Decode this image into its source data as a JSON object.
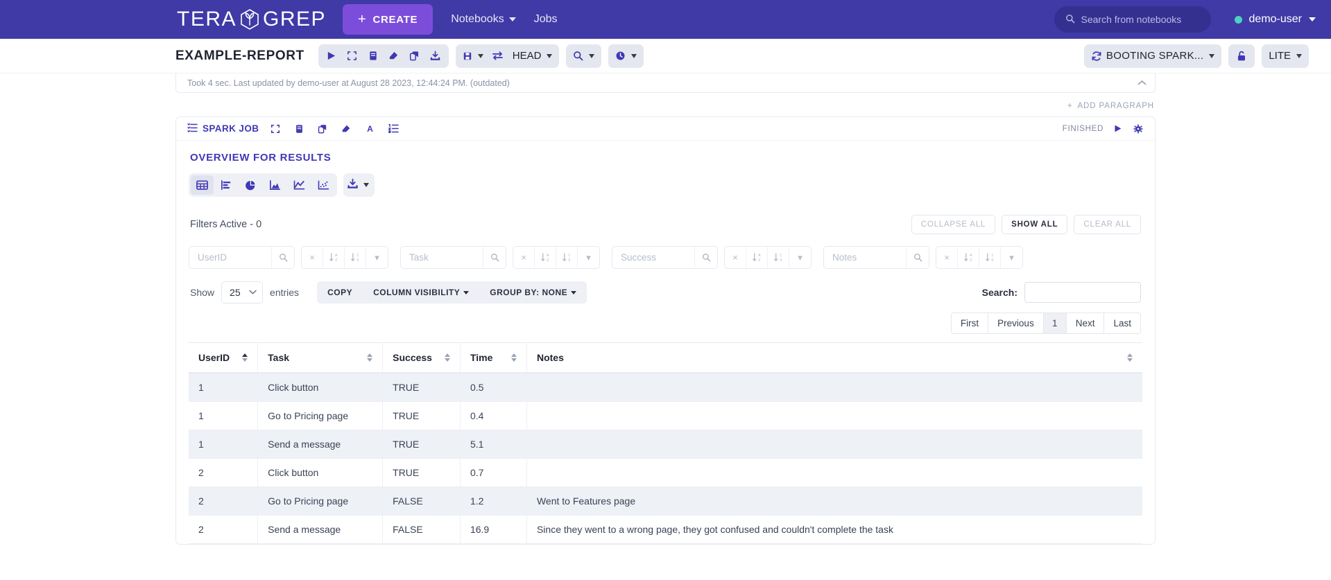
{
  "navbar": {
    "brand": "TERA GREP",
    "brand_left": "TERA",
    "brand_right": "GREP",
    "create_label": "CREATE",
    "create_plus": "+",
    "links": [
      {
        "label": "Notebooks",
        "has_caret": true
      },
      {
        "label": "Jobs",
        "has_caret": false
      }
    ],
    "search_placeholder": "Search from notebooks",
    "user": "demo-user",
    "accent": "#3f3aa6",
    "create_color": "#7c4ddb",
    "status_dot_color": "#4fd1c0"
  },
  "notebook_toolbar": {
    "title": "EXAMPLE-REPORT",
    "run_icons": [
      "run-icon",
      "collapse-icon",
      "list-icon",
      "eraser-icon",
      "clone-icon",
      "export-icon"
    ],
    "version_group": {
      "save_label": "",
      "revision_label": "HEAD"
    },
    "search_label": "",
    "clock_label": "",
    "spark_status": "BOOTING SPARK...",
    "lock_label": "",
    "mode_label": "LITE"
  },
  "status_line": {
    "text": "Took 4 sec. Last updated by demo-user at August 28 2023, 12:44:24 PM. (outdated)"
  },
  "add_paragraph": {
    "label": "ADD PARAGRAPH",
    "plus": "+"
  },
  "paragraph": {
    "tag": "SPARK JOB",
    "icons": [
      "expand-icon",
      "book-icon",
      "clone-icon",
      "eraser-icon",
      "font-icon",
      "order-list-icon"
    ],
    "status": "FINISHED",
    "overview_title": "OVERVIEW FOR RESULTS"
  },
  "viz": {
    "buttons": [
      {
        "name": "table-view-icon",
        "active": true
      },
      {
        "name": "bar-chart-icon",
        "active": false
      },
      {
        "name": "pie-chart-icon",
        "active": false
      },
      {
        "name": "area-chart-icon",
        "active": false
      },
      {
        "name": "line-chart-icon",
        "active": false
      },
      {
        "name": "scatter-chart-icon",
        "active": false
      }
    ],
    "download_icon": "download-icon"
  },
  "filters": {
    "active_label": "Filters Active - 0",
    "collapse_all": "COLLAPSE ALL",
    "show_all": "SHOW ALL",
    "clear_all": "CLEAR ALL",
    "columns": [
      {
        "placeholder": "UserID",
        "value": ""
      },
      {
        "placeholder": "Task",
        "value": ""
      },
      {
        "placeholder": "Success",
        "value": ""
      },
      {
        "placeholder": "Notes",
        "value": ""
      }
    ],
    "clear_glyph": "×",
    "sort_az_glyph": "↓A\nZ",
    "sort_num_glyph": "↓1\n9",
    "more_glyph": "▾"
  },
  "table_controls": {
    "show_label": "Show",
    "entries_value": "25",
    "entries_label": "entries",
    "copy_label": "COPY",
    "column_visibility_label": "COLUMN VISIBILITY",
    "group_by_label": "GROUP BY: NONE",
    "search_label": "Search:",
    "search_value": "",
    "pagination": {
      "first": "First",
      "previous": "Previous",
      "current": "1",
      "next": "Next",
      "last": "Last"
    }
  },
  "table": {
    "columns": [
      {
        "label": "UserID",
        "sorted": "asc"
      },
      {
        "label": "Task",
        "sorted": "none"
      },
      {
        "label": "Success",
        "sorted": "none"
      },
      {
        "label": "Time",
        "sorted": "none"
      },
      {
        "label": "Notes",
        "sorted": "none"
      }
    ],
    "rows": [
      {
        "UserID": "1",
        "Task": "Click button",
        "Success": "TRUE",
        "Time": "0.5",
        "Notes": ""
      },
      {
        "UserID": "1",
        "Task": "Go to Pricing page",
        "Success": "TRUE",
        "Time": "0.4",
        "Notes": ""
      },
      {
        "UserID": "1",
        "Task": "Send a message",
        "Success": "TRUE",
        "Time": "5.1",
        "Notes": ""
      },
      {
        "UserID": "2",
        "Task": "Click button",
        "Success": "TRUE",
        "Time": "0.7",
        "Notes": ""
      },
      {
        "UserID": "2",
        "Task": "Go to Pricing page",
        "Success": "FALSE",
        "Time": "1.2",
        "Notes": "Went to Features page"
      },
      {
        "UserID": "2",
        "Task": "Send a message",
        "Success": "FALSE",
        "Time": "16.9",
        "Notes": "Since they went to a wrong page, they got confused and couldn't complete the task"
      }
    ]
  }
}
